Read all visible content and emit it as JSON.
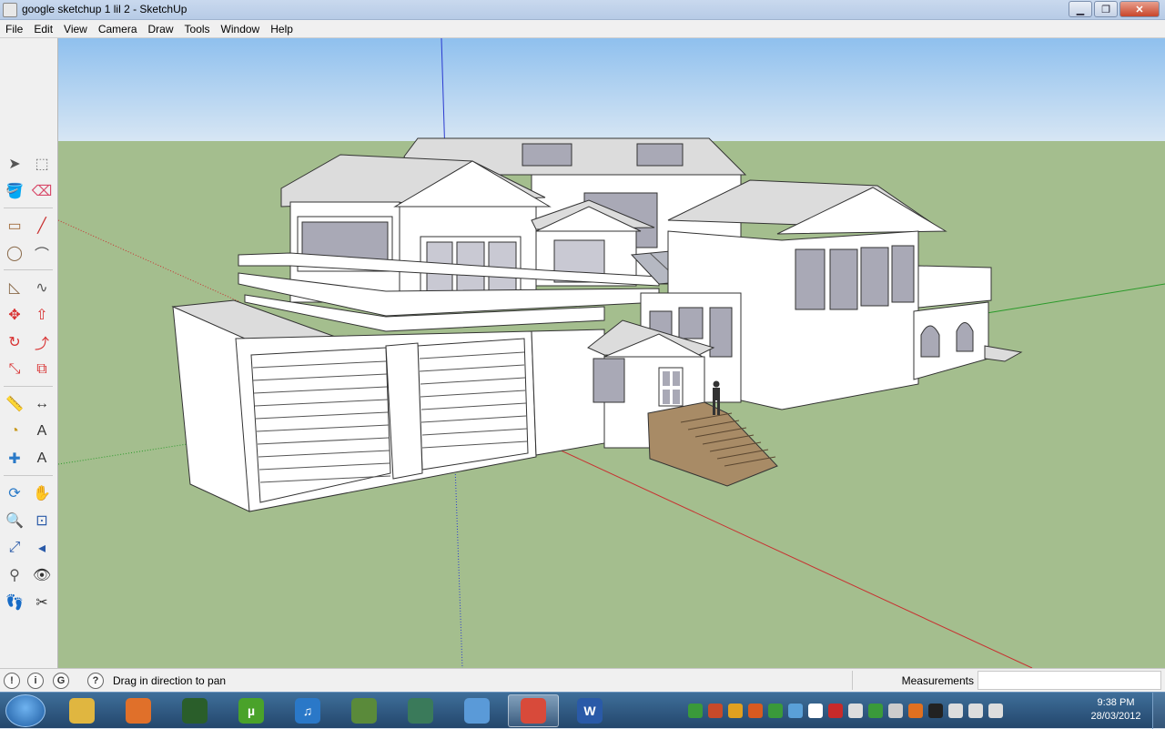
{
  "window": {
    "title": "google sketchup 1 lil 2 - SketchUp",
    "controls": [
      "minimize",
      "maximize",
      "close"
    ]
  },
  "menu": [
    "File",
    "Edit",
    "View",
    "Camera",
    "Draw",
    "Tools",
    "Window",
    "Help"
  ],
  "toolbar": {
    "tools": [
      "select-icon",
      "make-component-icon",
      "paint-bucket-icon",
      "eraser-icon",
      "rectangle-icon",
      "line-icon",
      "circle-icon",
      "arc-icon",
      "polygon-icon",
      "freehand-icon",
      "move-icon",
      "push-pull-icon",
      "rotate-icon",
      "follow-me-icon",
      "scale-icon",
      "offset-icon",
      "tape-measure-icon",
      "dimension-icon",
      "protractor-icon",
      "text-icon",
      "axes-icon",
      "3d-text-icon",
      "orbit-icon",
      "pan-icon",
      "zoom-icon",
      "zoom-window-icon",
      "zoom-extents-icon",
      "previous-view-icon",
      "position-camera-icon",
      "look-around-icon",
      "walk-icon",
      "section-plane-icon"
    ]
  },
  "status": {
    "icons": [
      "geo-location-icon",
      "credits-icon",
      "sign-in-icon",
      "help-icon"
    ],
    "hint": "Drag in direction to pan",
    "measurements_label": "Measurements",
    "measurements_value": ""
  },
  "taskbar": {
    "apps": [
      {
        "name": "explorer",
        "glyph": "",
        "color": "#e0b640"
      },
      {
        "name": "firefox",
        "glyph": "",
        "color": "#e0702a"
      },
      {
        "name": "monitor",
        "glyph": "",
        "color": "#2a5e2a"
      },
      {
        "name": "utorrent",
        "glyph": "µ",
        "color": "#4aa22a"
      },
      {
        "name": "itunes",
        "glyph": "♫",
        "color": "#2a78c8"
      },
      {
        "name": "minecraft",
        "glyph": "",
        "color": "#5a8a3a"
      },
      {
        "name": "terminal",
        "glyph": "",
        "color": "#3a7a5a"
      },
      {
        "name": "network",
        "glyph": "",
        "color": "#5a9ad8"
      },
      {
        "name": "sketchup",
        "glyph": "",
        "color": "#d84a3a"
      },
      {
        "name": "word",
        "glyph": "W",
        "color": "#2a5aa8"
      }
    ],
    "clock_time": "9:38 PM",
    "clock_date": "28/03/2012"
  },
  "colors": {
    "sky": "#b9d6f2",
    "ground": "#a4be8e",
    "wall": "#ffffff",
    "roof": "#dcdcdc",
    "stairs": "#a88b66",
    "window_glass": "#a9a9b6"
  }
}
